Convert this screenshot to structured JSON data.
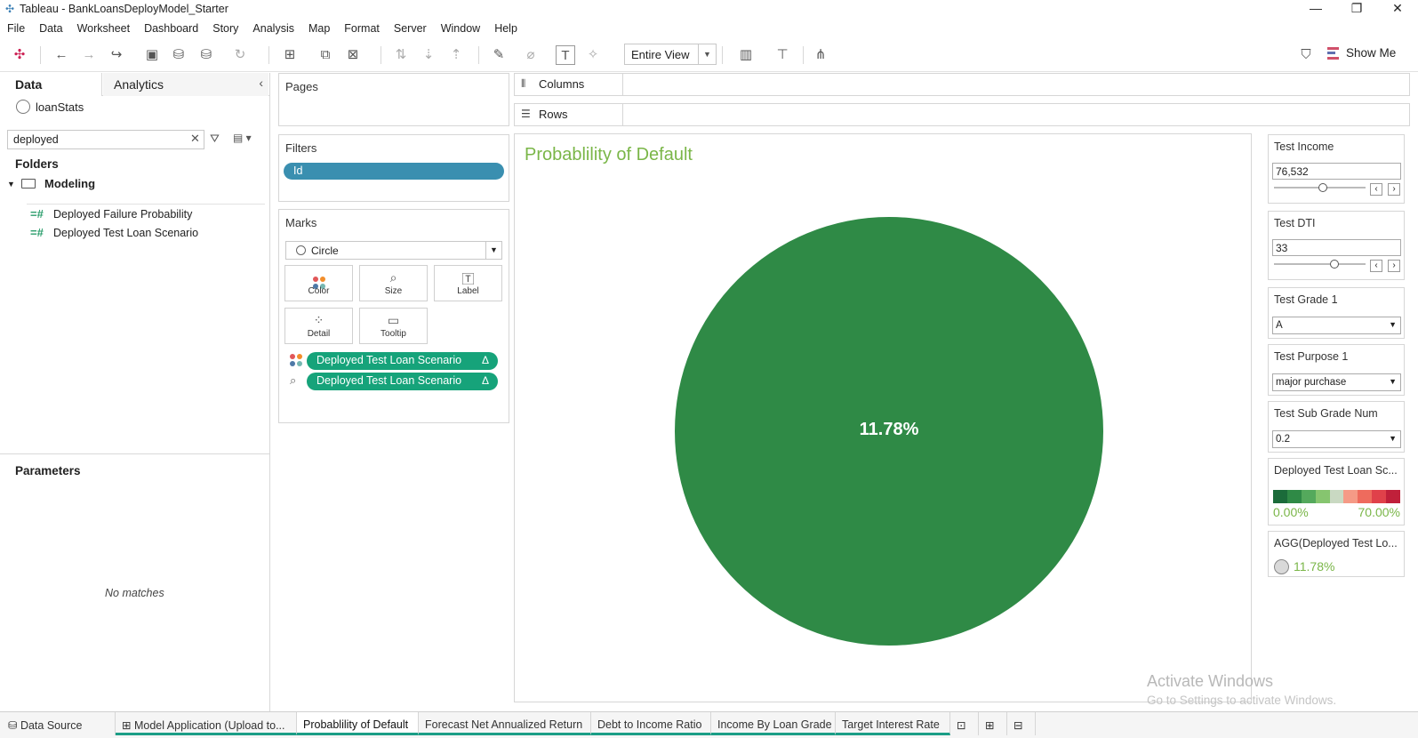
{
  "window": {
    "title": "Tableau - BankLoansDeployModel_Starter",
    "minimize": "—",
    "maximize": "❐",
    "close": "✕"
  },
  "menu": [
    "File",
    "Data",
    "Worksheet",
    "Dashboard",
    "Story",
    "Analysis",
    "Map",
    "Format",
    "Server",
    "Window",
    "Help"
  ],
  "toolbar": {
    "view_select": "Entire View",
    "show_me": "Show Me"
  },
  "datapane": {
    "tab_data": "Data",
    "tab_analytics": "Analytics",
    "datasource": "loanStats",
    "search_value": "deployed",
    "folders_header": "Folders",
    "folder_name": "Modeling",
    "fields": [
      "Deployed Failure Probability",
      "Deployed Test Loan Scenario"
    ],
    "parameters_header": "Parameters",
    "no_matches": "No matches"
  },
  "shelves": {
    "pages": "Pages",
    "filters": "Filters",
    "filter_pill": "Id",
    "marks": "Marks",
    "mark_type": "Circle",
    "mark_buttons": [
      "Color",
      "Size",
      "Label",
      "Detail",
      "Tooltip"
    ],
    "mark_pills": [
      "Deployed Test Loan Scenario",
      "Deployed Test Loan Scenario"
    ],
    "delta": "Δ",
    "columns": "Columns",
    "rows": "Rows"
  },
  "view": {
    "title": "Probablility of Default",
    "label": "11.78%",
    "color": "#2f8a46",
    "title_color": "#7ab648"
  },
  "controls": {
    "test_income": {
      "title": "Test Income",
      "value": "76,532",
      "slider_pos": 0.53
    },
    "test_dti": {
      "title": "Test DTI",
      "value": "33",
      "slider_pos": 0.66
    },
    "test_grade": {
      "title": "Test Grade 1",
      "value": "A"
    },
    "test_purpose": {
      "title": "Test Purpose 1",
      "value": "major purchase"
    },
    "test_subgrade": {
      "title": "Test Sub Grade Num",
      "value": "0.2"
    },
    "legend": {
      "title": "Deployed Test Loan Sc...",
      "min": "0.00%",
      "max": "70.00%",
      "colors": [
        "#1b6b3a",
        "#2f8a46",
        "#54a95c",
        "#86c56f",
        "#c9d9c2",
        "#f59a86",
        "#ee6b5d",
        "#e0414a",
        "#c0203a"
      ]
    },
    "agg": {
      "title": "AGG(Deployed Test Lo...",
      "value": "11.78%"
    }
  },
  "watermark": {
    "line1": "Activate Windows",
    "line2": "Go to Settings to activate Windows."
  },
  "bottom_tabs": [
    "Data Source",
    "Model Application (Upload to...",
    "Probablility of Default",
    "Forecast Net Annualized Return",
    "Debt to Income Ratio",
    "Income By Loan Grade",
    "Target Interest Rate"
  ]
}
